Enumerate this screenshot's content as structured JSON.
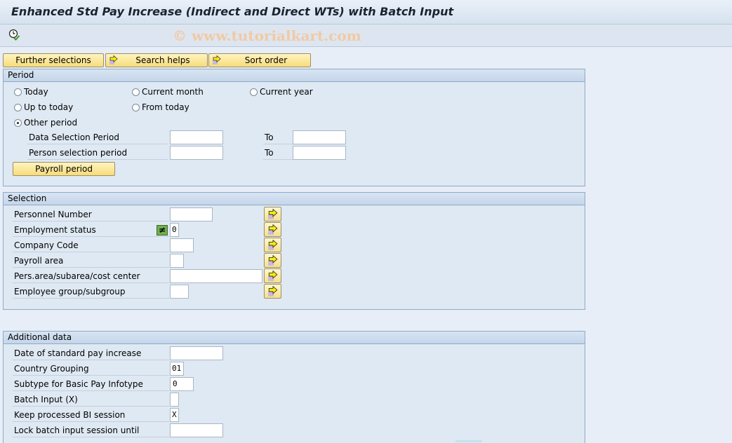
{
  "window": {
    "title": "Enhanced Std Pay Increase (Indirect and Direct WTs) with Batch Input",
    "watermark": "© www.tutorialkart.com"
  },
  "toolbar": {
    "execute_icon": "execute-clock-icon"
  },
  "top_buttons": {
    "further_selections": "Further selections",
    "search_helps": "Search helps",
    "sort_order": "Sort order"
  },
  "period": {
    "title": "Period",
    "radios": [
      {
        "label": "Today",
        "selected": false
      },
      {
        "label": "Current month",
        "selected": false
      },
      {
        "label": "Current year",
        "selected": false
      },
      {
        "label": "Up to today",
        "selected": false
      },
      {
        "label": "From today",
        "selected": false
      },
      {
        "label": "Other period",
        "selected": true
      }
    ],
    "data_selection_label": "Data Selection Period",
    "data_selection_from": "",
    "data_selection_to": "",
    "person_selection_label": "Person selection period",
    "person_selection_from": "",
    "person_selection_to": "",
    "to_label": "To",
    "payroll_period_button": "Payroll period"
  },
  "selection": {
    "title": "Selection",
    "fields": [
      {
        "label": "Personnel Number",
        "value": ""
      },
      {
        "label": "Employment status",
        "value": "0",
        "operator": "≠"
      },
      {
        "label": "Company Code",
        "value": ""
      },
      {
        "label": "Payroll area",
        "value": ""
      },
      {
        "label": "Pers.area/subarea/cost center",
        "value": ""
      },
      {
        "label": "Employee group/subgroup",
        "value": ""
      }
    ]
  },
  "additional": {
    "title": "Additional data",
    "fields": [
      {
        "label": "Date of standard pay increase",
        "value": ""
      },
      {
        "label": "Country Grouping",
        "value": "01"
      },
      {
        "label": "Subtype for Basic Pay Infotype",
        "value": "0"
      },
      {
        "label": "Batch Input (X)",
        "value": ""
      },
      {
        "label": "Keep processed BI session",
        "value": "X"
      },
      {
        "label": "Lock batch input session until",
        "value": ""
      }
    ]
  }
}
